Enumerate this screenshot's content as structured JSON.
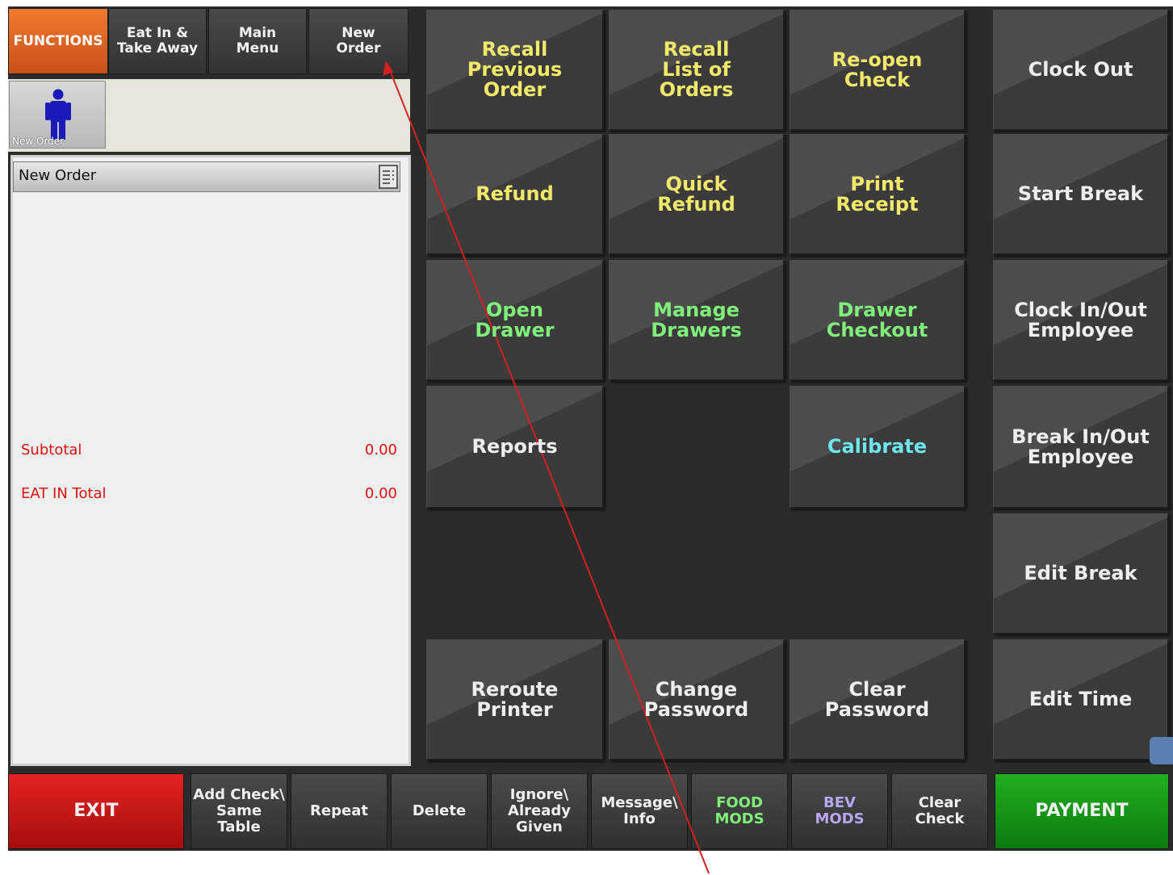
{
  "nav": {
    "functions": "FUNCTIONS",
    "eat_in": "Eat In &\nTake Away",
    "main_menu": "Main\nMenu",
    "new_order": "New\nOrder"
  },
  "order": {
    "tile_label": "New Order",
    "header": "New Order",
    "subtotal_label": "Subtotal",
    "subtotal_value": "0.00",
    "total_label": "EAT IN Total",
    "total_value": "0.00"
  },
  "functions": {
    "recall_previous": "Recall\nPrevious\nOrder",
    "recall_list": "Recall\nList of\nOrders",
    "reopen_check": "Re-open\nCheck",
    "clock_out": "Clock Out",
    "refund": "Refund",
    "quick_refund": "Quick\nRefund",
    "print_receipt": "Print\nReceipt",
    "start_break": "Start Break",
    "open_drawer": "Open\nDrawer",
    "manage_drawers": "Manage\nDrawers",
    "drawer_checkout": "Drawer\nCheckout",
    "clock_inout_employee": "Clock In/Out\nEmployee",
    "reports": "Reports",
    "calibrate": "Calibrate",
    "break_inout_employee": "Break In/Out\nEmployee",
    "edit_break": "Edit Break",
    "reroute_printer": "Reroute\nPrinter",
    "change_password": "Change\nPassword",
    "clear_password": "Clear\nPassword",
    "edit_time": "Edit Time"
  },
  "bottom": {
    "exit": "EXIT",
    "add_check": "Add Check\\\nSame\nTable",
    "repeat": "Repeat",
    "delete": "Delete",
    "ignore": "Ignore\\\nAlready\nGiven",
    "message": "Message\\\nInfo",
    "food_mods": "FOOD\nMODS",
    "bev_mods": "BEV\nMODS",
    "clear_check": "Clear\nCheck",
    "payment": "PAYMENT"
  },
  "colors": {
    "accent_orange": "#e06a24",
    "exit_red": "#d01818",
    "payment_green": "#14961a",
    "total_red": "#e01010",
    "annotation_red": "#d42020"
  }
}
